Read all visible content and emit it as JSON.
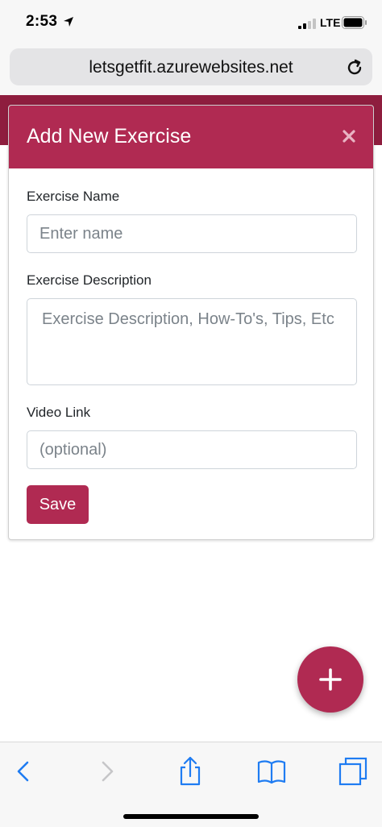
{
  "status_bar": {
    "time": "2:53",
    "network": "LTE"
  },
  "browser": {
    "url": "letsgetfit.azurewebsites.net"
  },
  "modal": {
    "title": "Add New Exercise",
    "fields": {
      "name_label": "Exercise Name",
      "name_placeholder": "Enter name",
      "description_label": "Exercise Description",
      "description_placeholder": "Exercise Description, How-To's, Tips, Etc",
      "video_label": "Video Link",
      "video_placeholder": "(optional)"
    },
    "save_label": "Save"
  },
  "colors": {
    "brand": "#b02a52",
    "header_dark": "#8e1d3e",
    "ios_blue": "#1f7cf2"
  },
  "icons": {
    "fab": "plus-icon",
    "toolbar": [
      "back-icon",
      "forward-icon",
      "share-icon",
      "bookmarks-icon",
      "tabs-icon"
    ]
  }
}
